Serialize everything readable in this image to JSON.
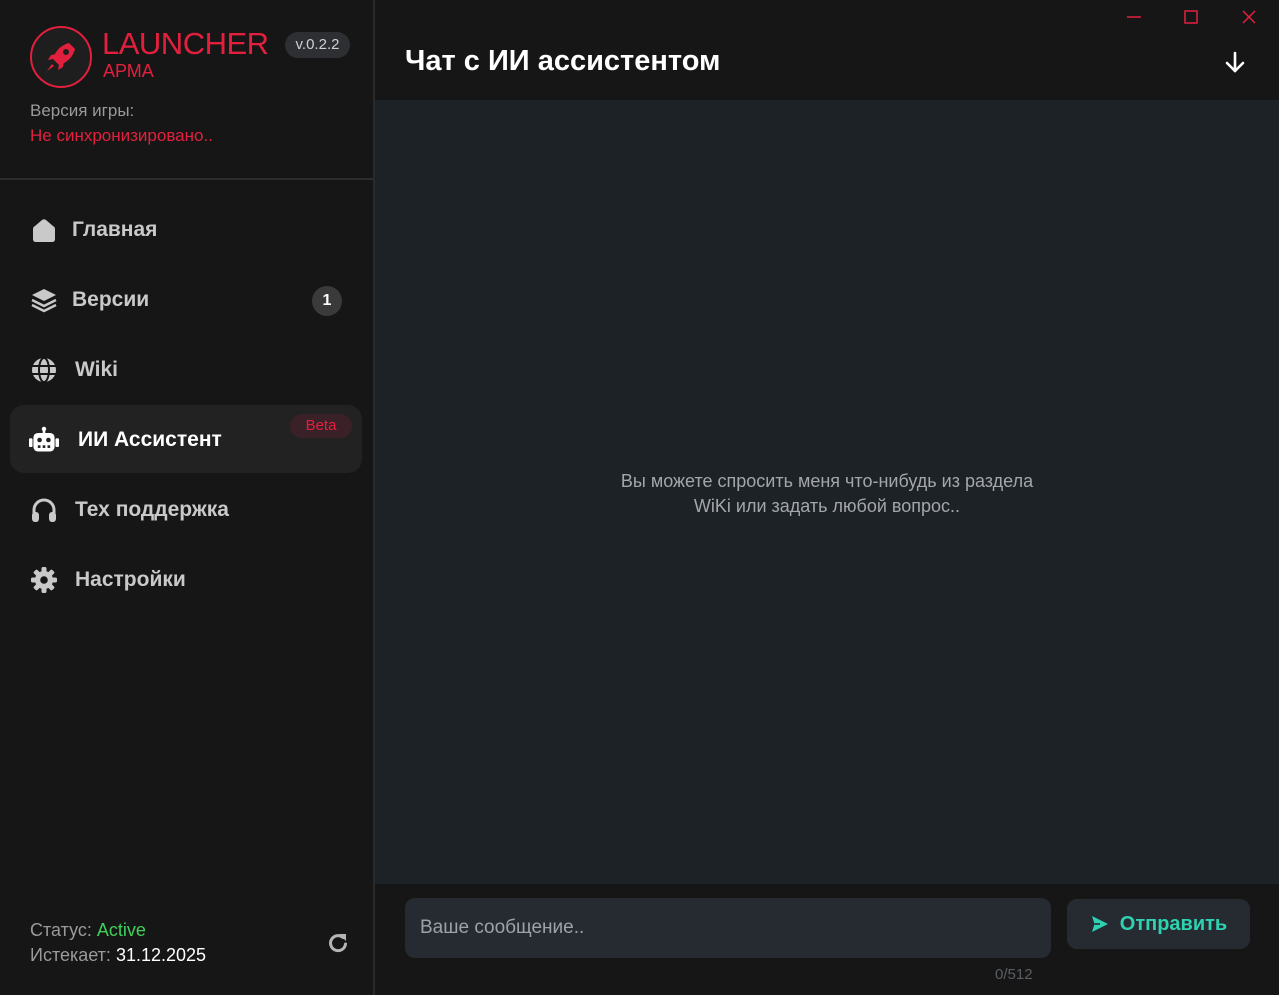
{
  "app": {
    "name": "LAUNCHER",
    "subtitle": "АРМА",
    "version": "v.0.2.2"
  },
  "game_version": {
    "label": "Версия игры:",
    "value": "Не синхронизировано.."
  },
  "sidebar": {
    "items": [
      {
        "label": "Главная",
        "icon": "home-icon"
      },
      {
        "label": "Версии",
        "icon": "layers-icon",
        "badge": "1"
      },
      {
        "label": "Wiki",
        "icon": "globe-icon"
      },
      {
        "label": "ИИ Ассистент",
        "icon": "robot-icon",
        "badge": "Beta",
        "active": true
      },
      {
        "label": "Тех поддержка",
        "icon": "headphones-icon"
      },
      {
        "label": "Настройки",
        "icon": "gear-icon"
      }
    ]
  },
  "status": {
    "label": "Статус:",
    "value": "Active",
    "expires_label": "Истекает:",
    "expires_value": "31.12.2025"
  },
  "header": {
    "title": "Чат с ИИ ассистентом"
  },
  "chat": {
    "empty_line1": "Вы можете спросить меня что-нибудь из раздела",
    "empty_line2": "WiKi или задать любой вопрос.."
  },
  "composer": {
    "placeholder": "Ваше сообщение..",
    "send_label": "Отправить",
    "counter": "0/512"
  },
  "colors": {
    "accent": "#e2203e",
    "send": "#2ed1b0",
    "active_status": "#3fcf5b"
  }
}
